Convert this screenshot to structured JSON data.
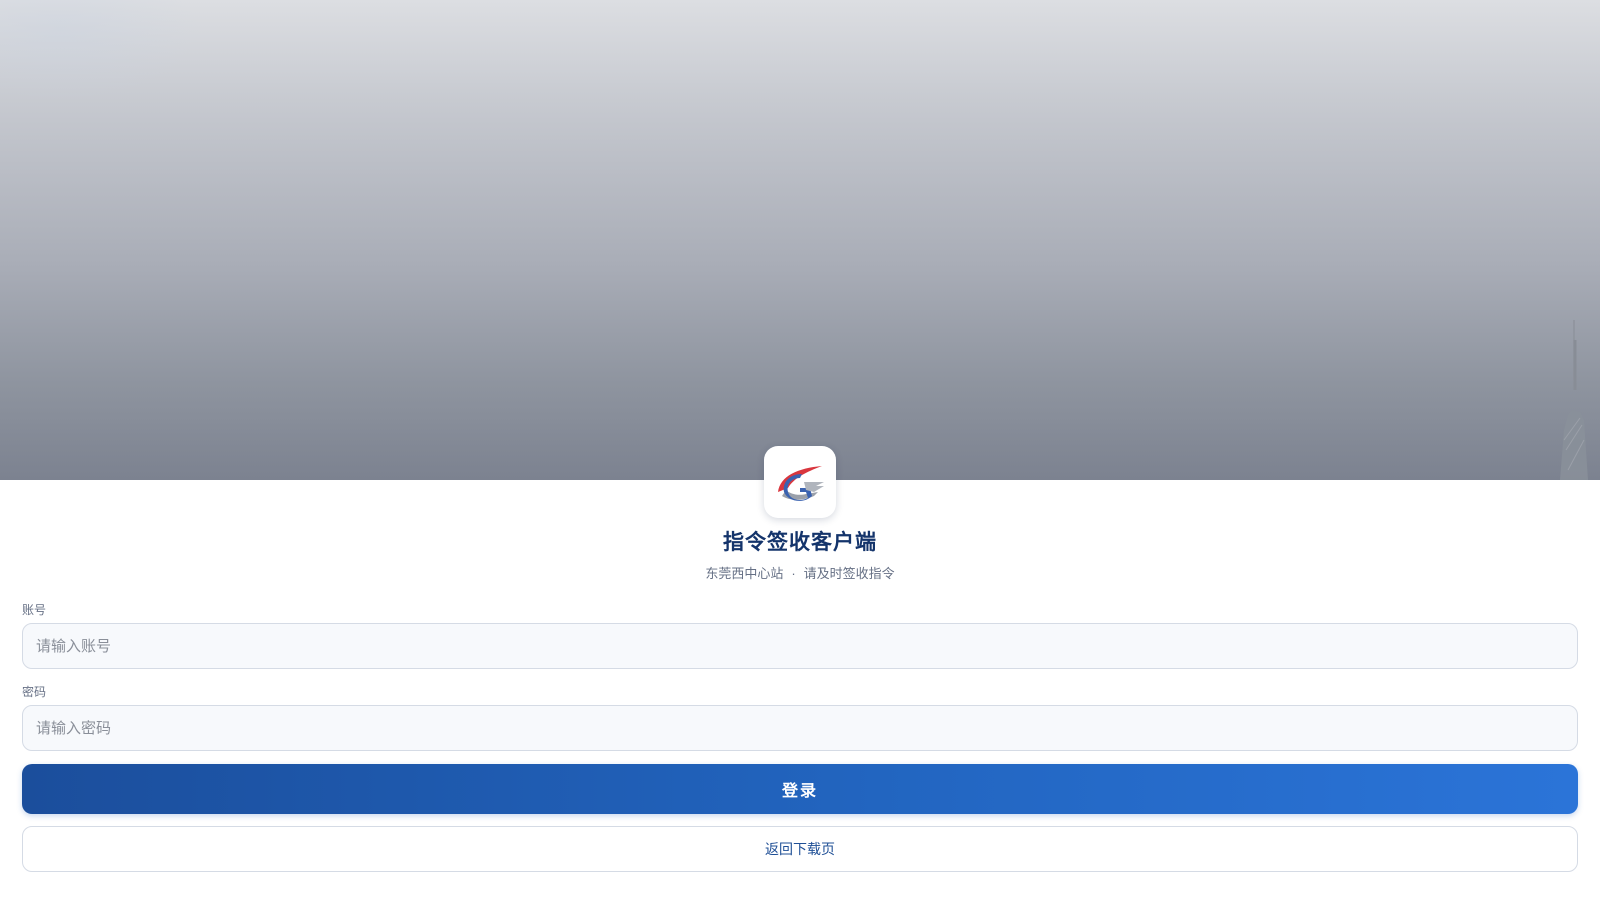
{
  "app": {
    "title": "指令签收客户端",
    "station": "东莞西中心站",
    "separator": "·",
    "tagline": "请及时签收指令",
    "logo_icon": "railway-logo-icon"
  },
  "form": {
    "account_label": "账号",
    "account_placeholder": "请输入账号",
    "account_value": "",
    "password_label": "密码",
    "password_placeholder": "请输入密码",
    "password_value": ""
  },
  "actions": {
    "login_label": "登录",
    "back_label": "返回下载页"
  },
  "colors": {
    "brand_primary": "#1f5aa8",
    "title_text": "#14346b",
    "logo_red": "#d9363e",
    "logo_blue": "#3a62b0",
    "logo_gray": "#9aa0aa"
  }
}
